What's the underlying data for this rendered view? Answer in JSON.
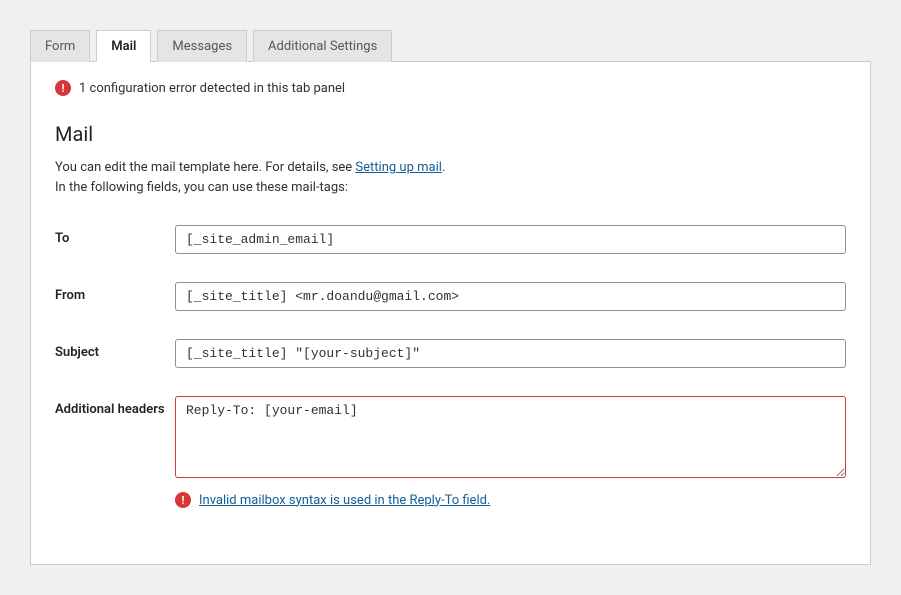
{
  "tabs": [
    {
      "label": "Form"
    },
    {
      "label": "Mail"
    },
    {
      "label": "Messages"
    },
    {
      "label": "Additional Settings"
    }
  ],
  "alert": {
    "message": "1 configuration error detected in this tab panel"
  },
  "section": {
    "title": "Mail",
    "desc_prefix": "You can edit the mail template here. For details, see ",
    "desc_link": "Setting up mail",
    "desc_suffix": ".",
    "desc_line2": "In the following fields, you can use these mail-tags:"
  },
  "fields": {
    "to": {
      "label": "To",
      "value": "[_site_admin_email]"
    },
    "from": {
      "label": "From",
      "value": "[_site_title] <mr.doandu@gmail.com>"
    },
    "subject": {
      "label": "Subject",
      "value": "[_site_title] \"[your-subject]\""
    },
    "additional_headers": {
      "label": "Additional headers",
      "value": "Reply-To: [your-email]",
      "error": "Invalid mailbox syntax is used in the Reply-To field."
    }
  }
}
